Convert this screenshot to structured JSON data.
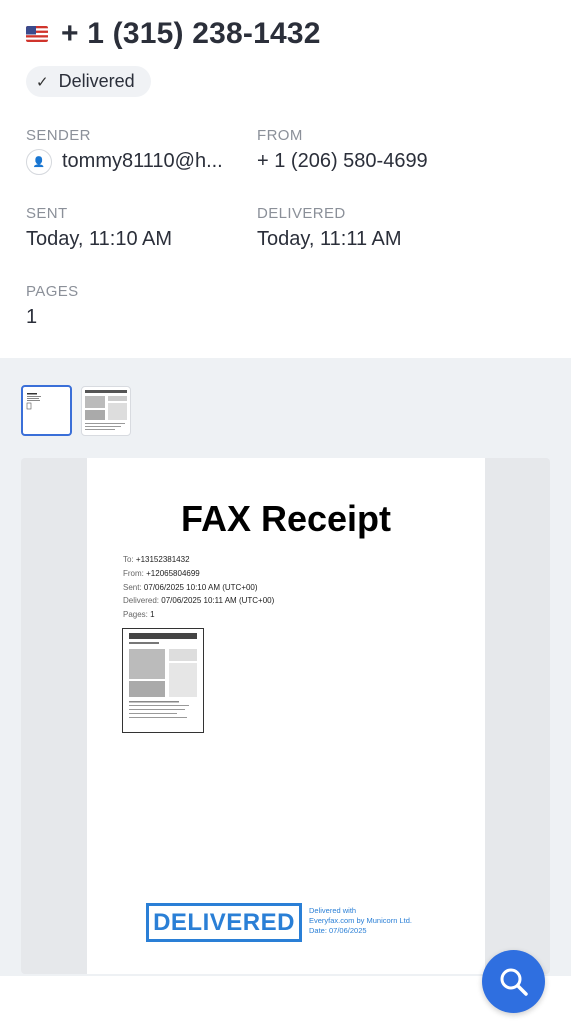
{
  "header": {
    "phone": "+ 1 (315) 238-1432",
    "status": "Delivered"
  },
  "details": {
    "sender_label": "SENDER",
    "sender_value": "tommy81110@h...",
    "from_label": "FROM",
    "from_value": "+ 1 (206) 580-4699",
    "sent_label": "SENT",
    "sent_value": "Today, 11:10 AM",
    "delivered_label": "DELIVERED",
    "delivered_value": "Today, 11:11 AM",
    "pages_label": "PAGES",
    "pages_value": "1"
  },
  "receipt": {
    "title": "FAX Receipt",
    "to_key": "To:",
    "to_val": "+13152381432",
    "from_key": "From:",
    "from_val": "+12065804699",
    "sent_key": "Sent:",
    "sent_val": "07/06/2025 10:10 AM (UTC+00)",
    "delivered_key": "Delivered:",
    "delivered_val": "07/06/2025 10:11 AM (UTC+00)",
    "pages_key": "Pages:",
    "pages_val": "1",
    "stamp": "DELIVERED",
    "note_line1": "Delivered with",
    "note_line2": "Everyfax.com by Municorn Ltd.",
    "note_line3": "Date: 07/06/2025"
  },
  "colors": {
    "accent": "#2f6fe0",
    "stamp": "#2a7fd6",
    "selected_thumb_border": "#3a6fd8"
  },
  "icons": {
    "flag": "us-flag-icon",
    "check": "check-icon",
    "avatar": "person-icon",
    "fab": "search-icon"
  }
}
